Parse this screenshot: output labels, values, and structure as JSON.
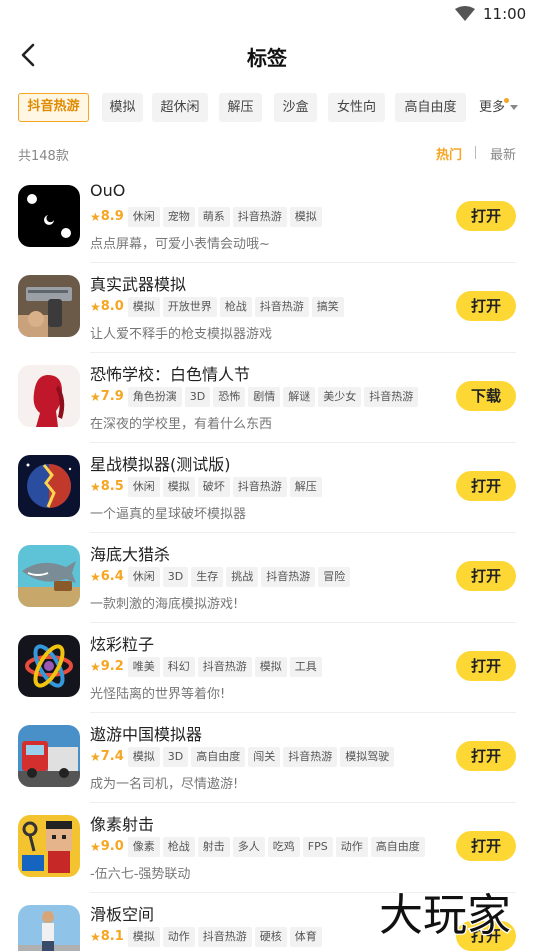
{
  "status_bar": {
    "time": "11:00"
  },
  "header": {
    "title": "标签"
  },
  "tags": [
    "抖音热游",
    "模拟",
    "超休闲",
    "解压",
    "沙盒",
    "女性向",
    "高自由度"
  ],
  "tags_more": "更多",
  "count_text": "共148款",
  "sort": {
    "hot": "热门",
    "new": "最新"
  },
  "accent_color": "#f5a623",
  "button_color": "#fdd835",
  "games": [
    {
      "name": "OuO",
      "score": "8.9",
      "tags": [
        "休闲",
        "宠物",
        "萌系",
        "抖音热游",
        "模拟"
      ],
      "desc": "点点屏幕，可爱小表情会动哦~",
      "action": "打开",
      "icon": "dice-face-icon"
    },
    {
      "name": "真实武器模拟",
      "score": "8.0",
      "tags": [
        "模拟",
        "开放世界",
        "枪战",
        "抖音热游",
        "搞笑"
      ],
      "desc": "让人爱不释手的枪支模拟器游戏",
      "action": "打开",
      "icon": "pistol-icon"
    },
    {
      "name": "恐怖学校：白色情人节",
      "score": "7.9",
      "tags": [
        "角色扮演",
        "3D",
        "恐怖",
        "剧情",
        "解谜",
        "美少女",
        "抖音热游"
      ],
      "desc": "在深夜的学校里，有着什么东西",
      "action": "下载",
      "icon": "girl-silhouette-icon"
    },
    {
      "name": "星战模拟器(测试版)",
      "score": "8.5",
      "tags": [
        "休闲",
        "模拟",
        "破坏",
        "抖音热游",
        "解压"
      ],
      "desc": "一个逼真的星球破坏模拟器",
      "action": "打开",
      "icon": "exploding-planet-icon"
    },
    {
      "name": "海底大猎杀",
      "score": "6.4",
      "tags": [
        "休闲",
        "3D",
        "生存",
        "挑战",
        "抖音热游",
        "冒险"
      ],
      "desc": "一款刺激的海底模拟游戏!",
      "action": "打开",
      "icon": "shark-icon"
    },
    {
      "name": "炫彩粒子",
      "score": "9.2",
      "tags": [
        "唯美",
        "科幻",
        "抖音热游",
        "模拟",
        "工具"
      ],
      "desc": "光怪陆离的世界等着你!",
      "action": "打开",
      "icon": "atom-icon"
    },
    {
      "name": "遨游中国模拟器",
      "score": "7.4",
      "tags": [
        "模拟",
        "3D",
        "高自由度",
        "闯关",
        "抖音热游",
        "模拟驾驶"
      ],
      "desc": "成为一名司机，尽情遨游!",
      "action": "打开",
      "icon": "truck-icon"
    },
    {
      "name": "像素射击",
      "score": "9.0",
      "tags": [
        "像素",
        "枪战",
        "射击",
        "多人",
        "吃鸡",
        "FPS",
        "动作",
        "高自由度"
      ],
      "desc": "-伍六七-强势联动",
      "action": "打开",
      "icon": "pixel-character-icon"
    },
    {
      "name": "滑板空间",
      "score": "8.1",
      "tags": [
        "模拟",
        "动作",
        "抖音热游",
        "硬核",
        "体育"
      ],
      "desc": "",
      "action": "打开",
      "icon": "skater-icon"
    }
  ],
  "watermark": "大玩家"
}
